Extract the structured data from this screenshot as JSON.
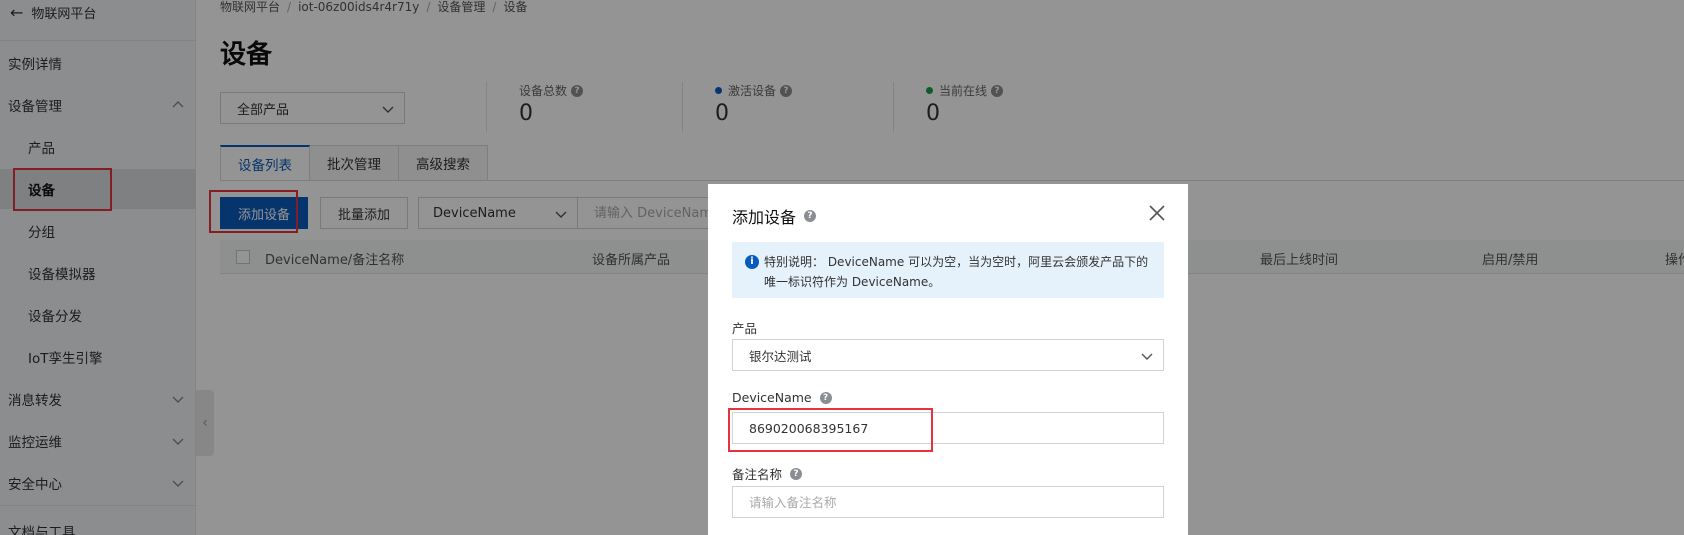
{
  "sidebar": {
    "back_label": "物联网平台",
    "items": [
      {
        "label": "实例详情"
      },
      {
        "label": "设备管理"
      },
      {
        "label": "产品"
      },
      {
        "label": "设备"
      },
      {
        "label": "分组"
      },
      {
        "label": "设备模拟器"
      },
      {
        "label": "设备分发"
      },
      {
        "label": "IoT孪生引擎"
      },
      {
        "label": "消息转发"
      },
      {
        "label": "监控运维"
      },
      {
        "label": "安全中心"
      },
      {
        "label": "文档与工具"
      }
    ]
  },
  "breadcrumb": [
    "物联网平台",
    "iot-06z00ids4r4r71y",
    "设备管理",
    "设备"
  ],
  "page": {
    "title": "设备",
    "product_select": "全部产品",
    "stats": [
      {
        "label": "设备总数",
        "value": "0",
        "dot_color": ""
      },
      {
        "label": "激活设备",
        "value": "0",
        "dot_color": "#0a5cba"
      },
      {
        "label": "当前在线",
        "value": "0",
        "dot_color": "#1e9e4a"
      }
    ],
    "tabs": [
      "设备列表",
      "批次管理",
      "高级搜索"
    ],
    "toolbar": {
      "add_device": "添加设备",
      "batch_add": "批量添加",
      "filter_field": "DeviceName",
      "filter_placeholder": "请输入 DeviceName"
    },
    "table_columns": [
      "DeviceName/备注名称",
      "设备所属产品",
      "最后上线时间",
      "启用/禁用",
      "操作"
    ]
  },
  "modal": {
    "title": "添加设备",
    "notice": "特别说明： DeviceName 可以为空，当为空时，阿里云会颁发产品下的唯一标识符作为 DeviceName。",
    "product_label": "产品",
    "product_value": "银尔达测试",
    "devicename_label": "DeviceName",
    "devicename_value": "869020068395167",
    "remark_label": "备注名称",
    "remark_placeholder": "请输入备注名称"
  },
  "colors": {
    "primary": "#0a5cba",
    "highlight": "#e5323e",
    "online": "#1e9e4a"
  }
}
